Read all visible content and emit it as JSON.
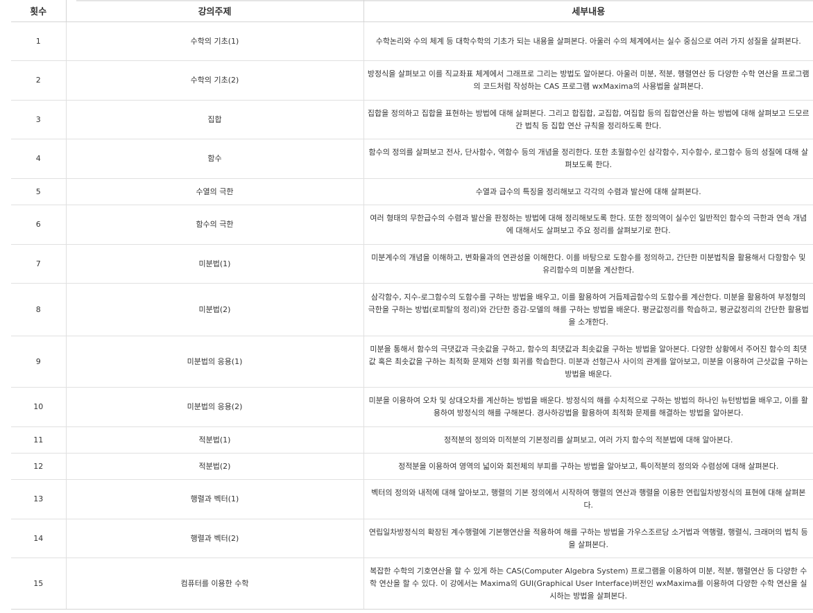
{
  "table": {
    "headers": {
      "no": "횟수",
      "topic": "강의주제",
      "detail": "세부내용"
    },
    "rows": [
      {
        "no": "1",
        "topic": "수학의 기초(1)",
        "detail": "수학논리와 수의 체계 등 대학수학의 기초가 되는 내용을 살펴본다. 아울러 수의 체계에서는 실수 중심으로 여러 가지 성질을 살펴본다."
      },
      {
        "no": "2",
        "topic": "수학의 기초(2)",
        "detail": "방정식을 살펴보고 이를 직교좌표 체계에서 그래프로 그리는 방법도 알아본다. 아울러 미분, 적분, 행렬연산 등 다양한 수학 연산을 프로그램의 코드처럼 작성하는 CAS 프로그램 wxMaxima의 사용법을 살펴본다."
      },
      {
        "no": "3",
        "topic": "집합",
        "detail": "집합을 정의하고 집합을 표현하는 방법에 대해 살펴본다. 그리고 합집합, 교집합, 여집합 등의 집합연산을 하는 방법에 대해 살펴보고 드모르간 법칙 등 집합 연산 규칙을 정리하도록 한다."
      },
      {
        "no": "4",
        "topic": "함수",
        "detail": "함수의 정의를 살펴보고 전사, 단사함수, 역함수 등의 개념을 정리한다. 또한 초월함수인 삼각함수, 지수함수, 로그함수 등의 성질에 대해 살펴보도록 한다."
      },
      {
        "no": "5",
        "topic": "수열의 극한",
        "detail": "수열과 급수의 특징을 정리해보고 각각의 수렴과 발산에 대해 살펴본다."
      },
      {
        "no": "6",
        "topic": "함수의 극한",
        "detail": "여러 형태의 무한급수의 수렴과 발산을 판정하는 방법에 대해 정리해보도록 한다. 또한 정의역이 실수인 일반적인 함수의 극한과 연속 개념에 대해서도 살펴보고 주요 정리를 살펴보기로 한다."
      },
      {
        "no": "7",
        "topic": "미분법(1)",
        "detail": "미분계수의 개념을 이해하고, 변화율과의 연관성을 이해한다. 이를 바탕으로 도함수를 정의하고, 간단한 미분법칙을 활용해서 다항함수 및 유리함수의 미분을 계산한다."
      },
      {
        "no": "8",
        "topic": "미분법(2)",
        "detail": "삼각함수, 지수-로그함수의 도함수를 구하는 방법을 배우고, 이를 활용하여 거듭제곱함수의 도함수를 계산한다. 미분을 활용하여 부정형의 극한을 구하는 방법(로피탈의 정리)와 간단한 증감-모델의 해를 구하는 방법을 배운다. 평균값정리를 학습하고, 평균값정리의 간단한 활용법을 소개한다."
      },
      {
        "no": "9",
        "topic": "미분법의 응용(1)",
        "detail": "미분을 통해서 함수의 극댓값과 극솟값을 구하고, 함수의 최댓값과 최솟값을 구하는 방법을 알아본다. 다양한 상황에서 주어진 함수의 최댓값 혹은 최솟값을 구하는 최적화 문제와 선형 회귀를 학습한다. 미분과 선형근사 사이의 관계를 알아보고, 미분을 이용하여 근삿값을 구하는 방법을 배운다."
      },
      {
        "no": "10",
        "topic": "미분법의 응용(2)",
        "detail": "미분을 이용하여 오차 및 상대오차를 계산하는 방법을 배운다. 방정식의 해를 수치적으로 구하는 방법의 하나인 뉴턴방법을 배우고, 이를 활용하여 방정식의 해를 구해본다. 경사하강법을 활용하여 최적화 문제를 해결하는 방법을 알아본다."
      },
      {
        "no": "11",
        "topic": "적분법(1)",
        "detail": "정적분의 정의와 미적분의 기본정리를 살펴보고, 여러 가지 함수의 적분법에 대해 알아본다."
      },
      {
        "no": "12",
        "topic": "적분법(2)",
        "detail": "정적분을 이용하여 영역의 넓이와 회전체의 부피를 구하는 방법을 알아보고, 특이적분의 정의와 수렴성에 대해 살펴본다."
      },
      {
        "no": "13",
        "topic": "행렬과 벡터(1)",
        "detail": "벡터의 정의와 내적에 대해 알아보고, 행렬의 기본 정의에서 시작하여 행렬의 연산과 행렬을 이용한 연립일차방정식의 표현에 대해 살펴본다."
      },
      {
        "no": "14",
        "topic": "행렬과 벡터(2)",
        "detail": "연립일차방정식의 확장된 계수행렬에 기본행연산을 적용하여 해를 구하는 방법을 가우스조르당 소거법과 역행렬, 행렬식, 크래머의 법칙 등을 살펴본다."
      },
      {
        "no": "15",
        "topic": "컴퓨터를 이용한 수학",
        "detail": "복잡한 수학의 기호연산을 할 수 있게 하는 CAS(Computer Algebra System) 프로그램을 이용하여 미분, 적분, 행렬연산 등 다양한 수학 연산을 할 수 있다. 이 강에서는 Maxima의 GUI(Graphical User Interface)버전인 wxMaxima를 이용하여 다양한 수학 연산을 실시하는 방법을 살펴본다."
      }
    ]
  }
}
